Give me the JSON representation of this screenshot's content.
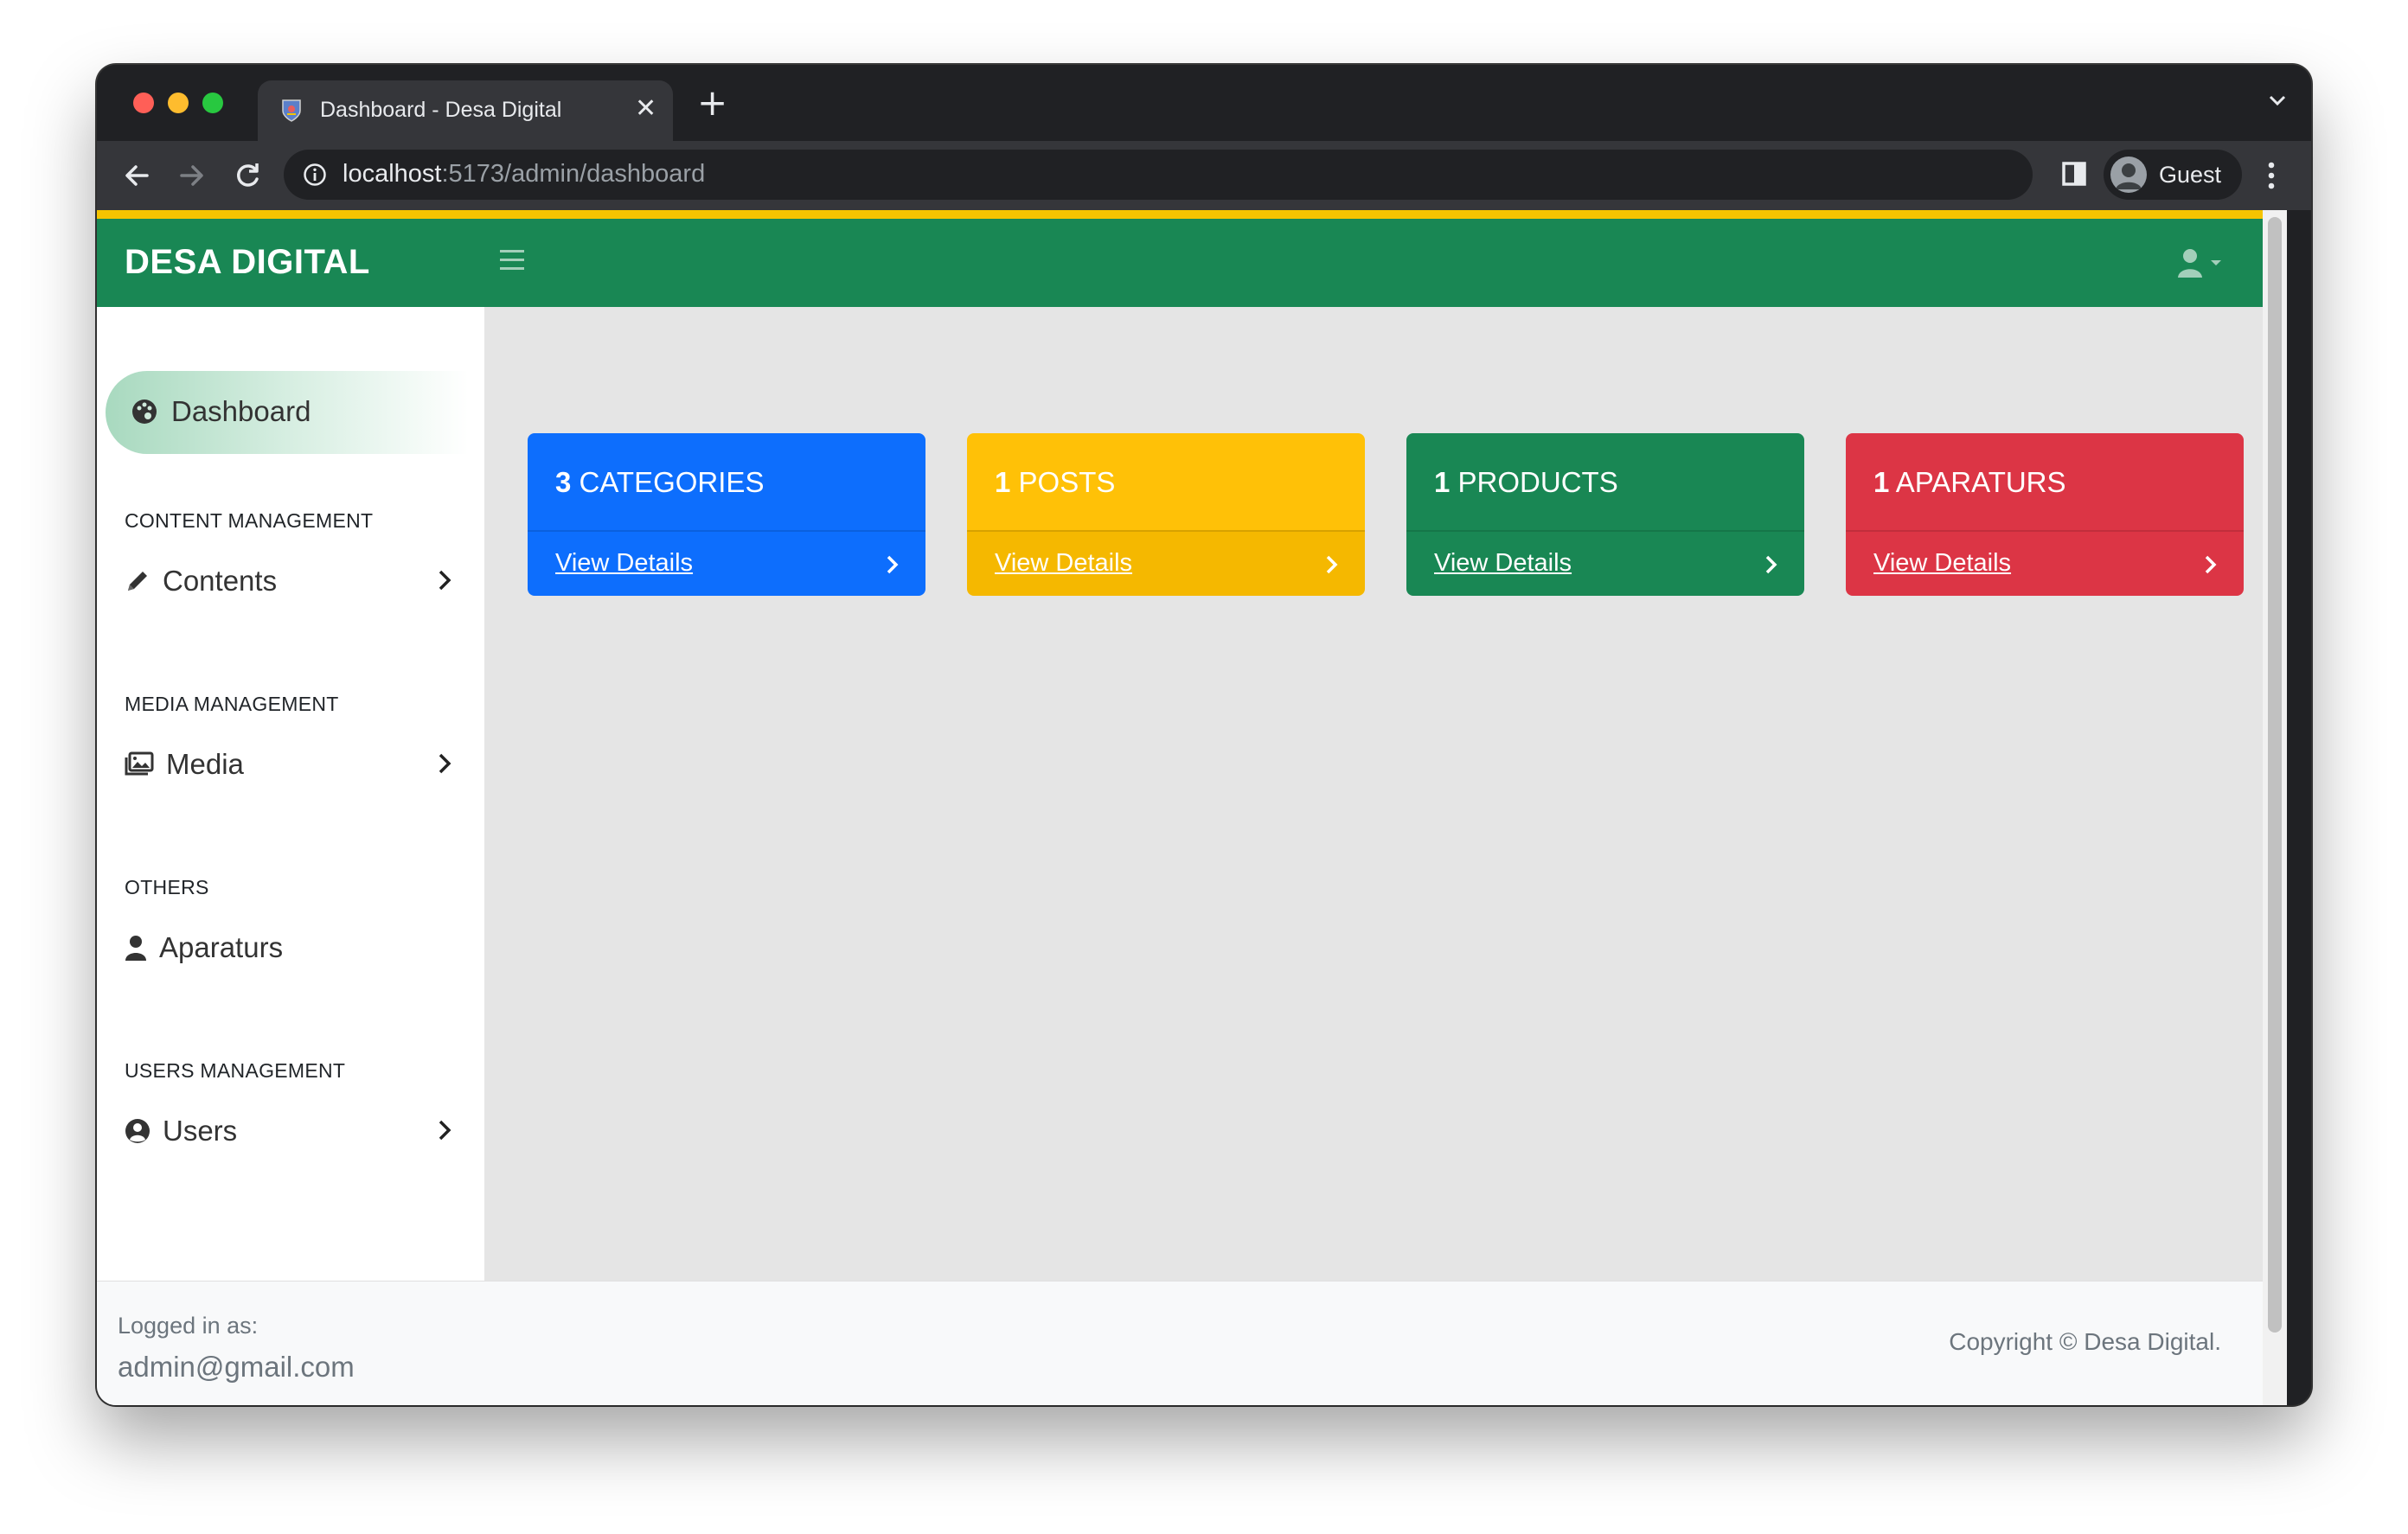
{
  "browser": {
    "tab_title": "Dashboard - Desa Digital",
    "tab_close": "✕",
    "new_tab": "+",
    "url_host": "localhost",
    "url_path": ":5173/admin/dashboard",
    "profile_label": "Guest"
  },
  "navbar": {
    "brand": "DESA DIGITAL"
  },
  "sidebar": {
    "active_item": {
      "label": "Dashboard",
      "icon": "palette-icon"
    },
    "sections": [
      {
        "heading": "CONTENT MANAGEMENT",
        "item": {
          "label": "Contents",
          "icon": "pencil-icon",
          "has_submenu": true
        }
      },
      {
        "heading": "MEDIA MANAGEMENT",
        "item": {
          "label": "Media",
          "icon": "images-icon",
          "has_submenu": true
        }
      },
      {
        "heading": "OTHERS",
        "item": {
          "label": "Aparaturs",
          "icon": "user-icon",
          "has_submenu": false
        }
      },
      {
        "heading": "USERS MANAGEMENT",
        "item": {
          "label": "Users",
          "icon": "user-circle-icon",
          "has_submenu": true
        }
      }
    ]
  },
  "cards": [
    {
      "count": "3",
      "label": "CATEGORIES",
      "link": "View Details",
      "color": "#0d6efd",
      "bottom_color": "#0d6efd",
      "text_color": "#ffffff"
    },
    {
      "count": "1",
      "label": "POSTS",
      "link": "View Details",
      "color": "#ffc107",
      "bottom_color": "#f5b800",
      "text_color": "#ffffff"
    },
    {
      "count": "1",
      "label": "PRODUCTS",
      "link": "View Details",
      "color": "#198754",
      "bottom_color": "#198754",
      "text_color": "#ffffff"
    },
    {
      "count": "1",
      "label": "APARATURS",
      "link": "View Details",
      "color": "#dc3545",
      "bottom_color": "#dc3545",
      "text_color": "#ffffff"
    }
  ],
  "footer": {
    "logged_in_label": "Logged in as:",
    "email": "admin@gmail.com",
    "copyright": "Copyright © Desa Digital."
  },
  "colors": {
    "navbar": "#198754",
    "accent_line": "#f5c400",
    "content_bg": "#e5e5e5"
  }
}
